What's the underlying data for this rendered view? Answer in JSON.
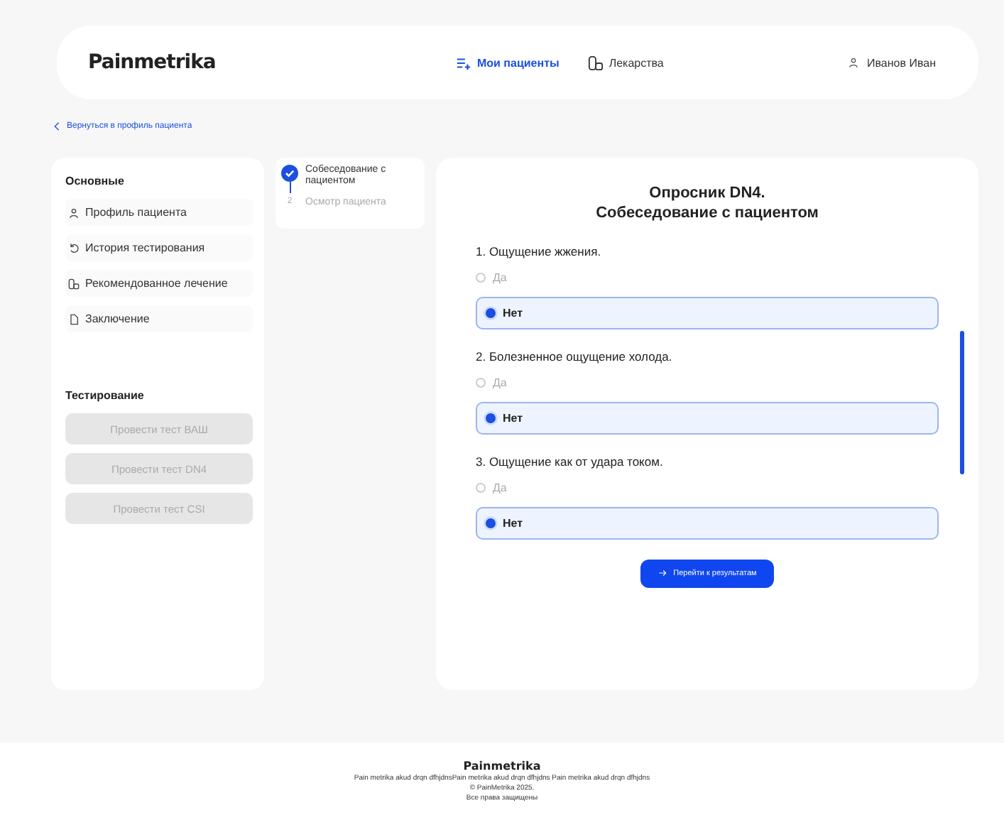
{
  "header": {
    "logo": "Painmetrika",
    "nav": [
      {
        "label": "Мои пациенты",
        "kind": "list",
        "selected": true
      },
      {
        "label": "Лекарства",
        "kind": "pills",
        "selected": false
      }
    ],
    "user": "Иванов Иван"
  },
  "back_link": "Вернуться в профиль пациента",
  "sidebar": {
    "sections": [
      {
        "title": "Основные",
        "kind": "links",
        "items": [
          {
            "label": "Профиль пациента",
            "kind": "user"
          },
          {
            "label": "История тестирования",
            "kind": "history"
          },
          {
            "label": "Рекомендованное лечение",
            "kind": "pills"
          },
          {
            "label": "Заключение",
            "kind": "doc"
          }
        ]
      },
      {
        "title": "Тестирование",
        "kind": "buttons",
        "items": [
          {
            "label": "Провести тест ВАШ",
            "disabled": true
          },
          {
            "label": "Провести тест DN4",
            "disabled": true
          },
          {
            "label": "Провести тест CSI",
            "disabled": true
          }
        ]
      }
    ]
  },
  "steps": [
    {
      "label": "Собеседование с пациентом",
      "done": true
    },
    {
      "label": "Осмотр пациента",
      "number": "2",
      "done": false
    }
  ],
  "form": {
    "title": "Опросник DN4.",
    "subtitle": "Собеседование с пациентом",
    "questions": [
      {
        "text": "1. Ощущение жжения.",
        "options": [
          {
            "label": "Да",
            "selected": false
          },
          {
            "label": "Нет",
            "selected": true
          }
        ]
      },
      {
        "text": "2. Болезненное ощущение холода.",
        "options": [
          {
            "label": "Да",
            "selected": false
          },
          {
            "label": "Нет",
            "selected": true
          }
        ]
      },
      {
        "text": "3. Ощущение как от удара током.",
        "options": [
          {
            "label": "Да",
            "selected": false
          },
          {
            "label": "Нет",
            "selected": true
          }
        ]
      }
    ],
    "submit": "Перейти к результатам"
  },
  "footer": {
    "logo": "Painmetrika",
    "text": "Pain metrika akud drqn dfhjdnsPain metrika akud drqn dfhjdns Pain metrika akud drqn dfhjdns",
    "copyright": "© PainMetrika 2025.",
    "rights": "Все права защищены"
  }
}
